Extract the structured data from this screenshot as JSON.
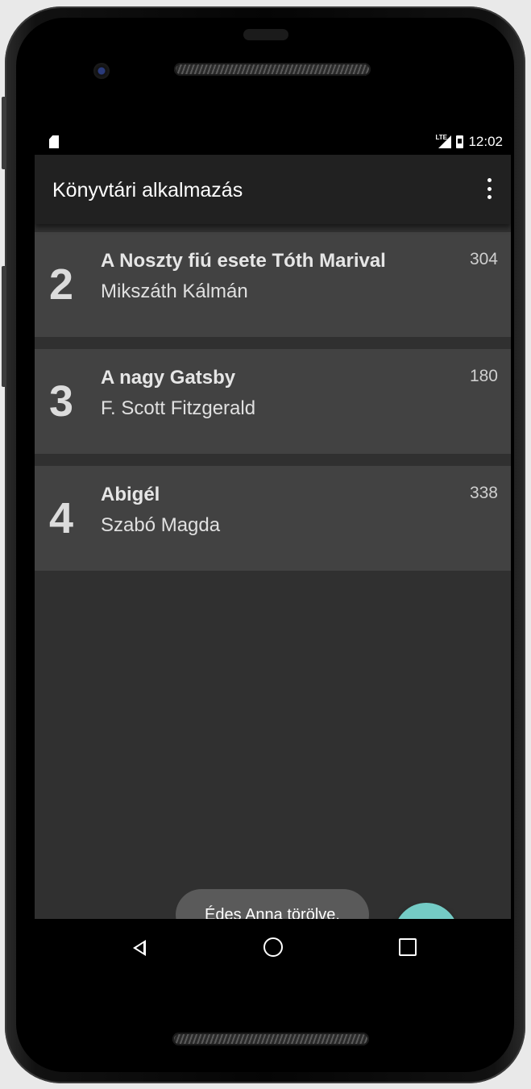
{
  "status_bar": {
    "time": "12:02",
    "left_icon": "sd-card-icon",
    "network_icon": "signal-lte-icon",
    "battery_icon": "battery-icon"
  },
  "app_bar": {
    "title": "Könyvtári alkalmazás",
    "menu_icon": "overflow-menu-icon"
  },
  "books": [
    {
      "number": "2",
      "title": "A Noszty fiú esete Tóth Marival",
      "author": "Mikszáth Kálmán",
      "pages": "304"
    },
    {
      "number": "3",
      "title": "A nagy Gatsby",
      "author": "F. Scott Fitzgerald",
      "pages": "180"
    },
    {
      "number": "4",
      "title": "Abigél",
      "author": "Szabó Magda",
      "pages": "338"
    }
  ],
  "toast": {
    "message": "Édes Anna törölve."
  },
  "fab": {
    "label": "+",
    "icon": "plus-icon",
    "color": "#74cbc5"
  },
  "nav_bar": {
    "back_icon": "back-triangle-icon",
    "home_icon": "home-circle-icon",
    "recents_icon": "recents-square-icon"
  },
  "colors": {
    "app_bar": "#212121",
    "background": "#303030",
    "card": "#424242",
    "accent": "#74cbc5"
  }
}
